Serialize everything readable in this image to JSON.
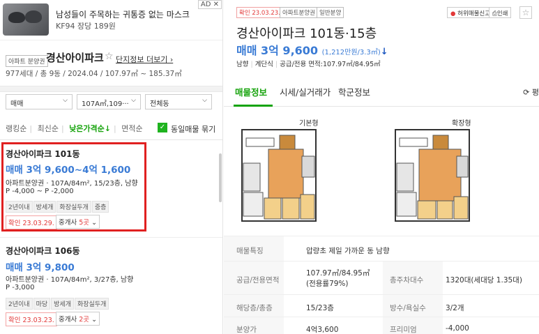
{
  "ad": {
    "title": "남성들이 주목하는 귀통증 없는 마스크",
    "subtitle": "KF94 장당 189원",
    "badge": "AD ✕"
  },
  "complex": {
    "chip": "아파트 분양권",
    "name": "경산아이파크",
    "star": "☆",
    "link": "단지정보 더보기 ›",
    "meta": "977세대 / 총 9동 / 2024.04 / 107.97㎡ ~ 185.37㎡"
  },
  "filters": {
    "trade": "매매",
    "area": "107A㎡,109···",
    "dong": "전체동"
  },
  "sort": {
    "items": [
      "랭킹순",
      "최신순",
      "낮은가격순↓",
      "면적순"
    ],
    "same_listing": "동일매물 묶기",
    "check": "✓"
  },
  "listings": [
    {
      "name": "경산아이파크 101동",
      "price": "매매 3억 9,600~4억 1,600",
      "desc": "아파트분양권 · 107A/84m², 15/23층, 남향",
      "premium": "P -4,000 ~ P -2,000",
      "tags": [
        "2년이내",
        "방세개",
        "화장실두개",
        "중층"
      ],
      "confirm": "확인 23.03.29.",
      "agent_prefix": "중개사 ",
      "agent_count": "5곳",
      "agent_suffix": " ⌄"
    },
    {
      "name": "경산아이파크 106동",
      "price": "매매 3억 9,800",
      "desc": "아파트분양권 · 107A/84m², 3/27층, 남향",
      "premium": "P -3,000",
      "tags": [
        "2년이내",
        "마당",
        "방세개",
        "화장실두개"
      ],
      "confirm": "확인 23.03.23.",
      "agent_prefix": "중개사 ",
      "agent_count": "2곳",
      "agent_suffix": " ⌄"
    }
  ],
  "detail": {
    "chips": [
      "확인 23.03.23.",
      "아파트분양권",
      "일반분양"
    ],
    "report_btn": "허위매물신고",
    "print_btn": "인쇄",
    "star": "☆",
    "title": "경산아이파크 101동·15층",
    "price": "매매 3억 9,600",
    "price_unit": "(1,212만원/3.3㎡)",
    "price_arrow": "↓",
    "meta": [
      "남향",
      "계단식",
      "공급/전용 면적:107.97㎡/84.95㎡"
    ],
    "tabs": [
      "매물정보",
      "시세/실거래가",
      "학군정보"
    ],
    "refresh": "⟳ 평",
    "plan_labels": [
      "기본형",
      "확장형"
    ],
    "info": [
      {
        "k": "매물특징",
        "v": "압량초 제일 가까운 동 남향"
      },
      {
        "k": "공급/전용면적",
        "v": "107.97㎡/84.95㎡(전용률79%)",
        "k2": "총주차대수",
        "v2": "1320대(세대당 1.35대)"
      },
      {
        "k": "해당층/총층",
        "v": "15/23층",
        "k2": "방수/욕실수",
        "v2": "3/2개"
      },
      {
        "k": "분양가",
        "v": "4억3,600",
        "k2": "프리미엄",
        "v2": "-4,000"
      }
    ]
  }
}
